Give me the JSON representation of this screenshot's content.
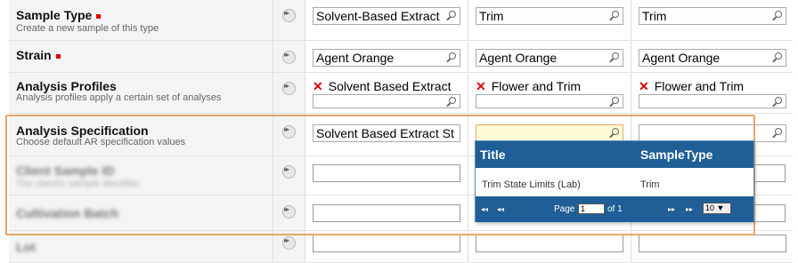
{
  "rows": [
    {
      "title": "Sample Type",
      "required": true,
      "desc": "Create a new sample of this type",
      "values": [
        "Solvent-Based Extract",
        "Trim",
        "Trim"
      ]
    },
    {
      "title": "Strain",
      "required": true,
      "desc": "",
      "values": [
        "Agent Orange",
        "Agent Orange",
        "Agent Orange"
      ]
    },
    {
      "title": "Analysis Profiles",
      "required": false,
      "desc": "Analysis profiles apply a certain set of analyses",
      "chips": [
        "Solvent Based Extract",
        "Flower and Trim",
        "Flower and Trim"
      ]
    },
    {
      "title": "Analysis Specification",
      "required": false,
      "desc": "Choose default AR specification values",
      "values": [
        "Solvent Based Extract St",
        "",
        ""
      ]
    },
    {
      "title": "Client Sample ID",
      "desc": "The client's sample identifier"
    },
    {
      "title": "Cultivation Batch",
      "desc": ""
    },
    {
      "title": "Lot",
      "desc": ""
    }
  ],
  "popup": {
    "headers": [
      "Title",
      "SampleType"
    ],
    "rows": [
      [
        "Trim State Limits (Lab)",
        "Trim"
      ]
    ],
    "pager": {
      "first": "◂◂",
      "prev": "◂◂",
      "page_label": "Page",
      "page_value": "1",
      "of_label": "of 1",
      "next": "▸▸",
      "last": "▸▸",
      "page_size": "10 ▼"
    }
  },
  "colors": {
    "accent": "#1f5e96",
    "highlight": "#e3a868",
    "required": "#dd0000",
    "error_x": "#dd0000"
  }
}
